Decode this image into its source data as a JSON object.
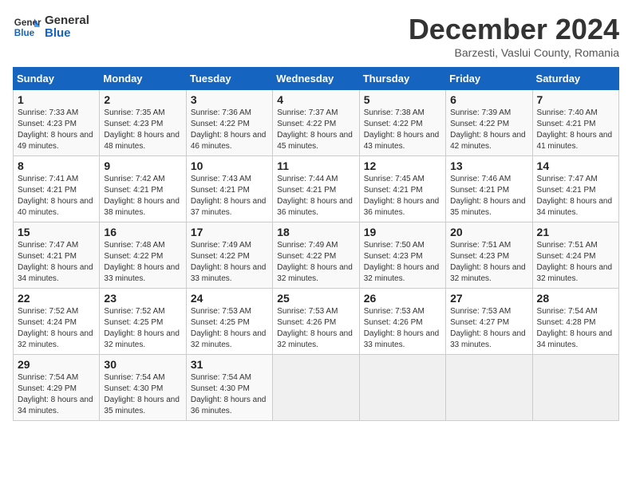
{
  "header": {
    "logo_line1": "General",
    "logo_line2": "Blue",
    "month": "December 2024",
    "location": "Barzesti, Vaslui County, Romania"
  },
  "weekdays": [
    "Sunday",
    "Monday",
    "Tuesday",
    "Wednesday",
    "Thursday",
    "Friday",
    "Saturday"
  ],
  "weeks": [
    [
      {
        "day": "1",
        "sunrise": "7:33 AM",
        "sunset": "4:23 PM",
        "daylight": "8 hours and 49 minutes."
      },
      {
        "day": "2",
        "sunrise": "7:35 AM",
        "sunset": "4:23 PM",
        "daylight": "8 hours and 48 minutes."
      },
      {
        "day": "3",
        "sunrise": "7:36 AM",
        "sunset": "4:22 PM",
        "daylight": "8 hours and 46 minutes."
      },
      {
        "day": "4",
        "sunrise": "7:37 AM",
        "sunset": "4:22 PM",
        "daylight": "8 hours and 45 minutes."
      },
      {
        "day": "5",
        "sunrise": "7:38 AM",
        "sunset": "4:22 PM",
        "daylight": "8 hours and 43 minutes."
      },
      {
        "day": "6",
        "sunrise": "7:39 AM",
        "sunset": "4:22 PM",
        "daylight": "8 hours and 42 minutes."
      },
      {
        "day": "7",
        "sunrise": "7:40 AM",
        "sunset": "4:21 PM",
        "daylight": "8 hours and 41 minutes."
      }
    ],
    [
      {
        "day": "8",
        "sunrise": "7:41 AM",
        "sunset": "4:21 PM",
        "daylight": "8 hours and 40 minutes."
      },
      {
        "day": "9",
        "sunrise": "7:42 AM",
        "sunset": "4:21 PM",
        "daylight": "8 hours and 38 minutes."
      },
      {
        "day": "10",
        "sunrise": "7:43 AM",
        "sunset": "4:21 PM",
        "daylight": "8 hours and 37 minutes."
      },
      {
        "day": "11",
        "sunrise": "7:44 AM",
        "sunset": "4:21 PM",
        "daylight": "8 hours and 36 minutes."
      },
      {
        "day": "12",
        "sunrise": "7:45 AM",
        "sunset": "4:21 PM",
        "daylight": "8 hours and 36 minutes."
      },
      {
        "day": "13",
        "sunrise": "7:46 AM",
        "sunset": "4:21 PM",
        "daylight": "8 hours and 35 minutes."
      },
      {
        "day": "14",
        "sunrise": "7:47 AM",
        "sunset": "4:21 PM",
        "daylight": "8 hours and 34 minutes."
      }
    ],
    [
      {
        "day": "15",
        "sunrise": "7:47 AM",
        "sunset": "4:21 PM",
        "daylight": "8 hours and 34 minutes."
      },
      {
        "day": "16",
        "sunrise": "7:48 AM",
        "sunset": "4:22 PM",
        "daylight": "8 hours and 33 minutes."
      },
      {
        "day": "17",
        "sunrise": "7:49 AM",
        "sunset": "4:22 PM",
        "daylight": "8 hours and 33 minutes."
      },
      {
        "day": "18",
        "sunrise": "7:49 AM",
        "sunset": "4:22 PM",
        "daylight": "8 hours and 32 minutes."
      },
      {
        "day": "19",
        "sunrise": "7:50 AM",
        "sunset": "4:23 PM",
        "daylight": "8 hours and 32 minutes."
      },
      {
        "day": "20",
        "sunrise": "7:51 AM",
        "sunset": "4:23 PM",
        "daylight": "8 hours and 32 minutes."
      },
      {
        "day": "21",
        "sunrise": "7:51 AM",
        "sunset": "4:24 PM",
        "daylight": "8 hours and 32 minutes."
      }
    ],
    [
      {
        "day": "22",
        "sunrise": "7:52 AM",
        "sunset": "4:24 PM",
        "daylight": "8 hours and 32 minutes."
      },
      {
        "day": "23",
        "sunrise": "7:52 AM",
        "sunset": "4:25 PM",
        "daylight": "8 hours and 32 minutes."
      },
      {
        "day": "24",
        "sunrise": "7:53 AM",
        "sunset": "4:25 PM",
        "daylight": "8 hours and 32 minutes."
      },
      {
        "day": "25",
        "sunrise": "7:53 AM",
        "sunset": "4:26 PM",
        "daylight": "8 hours and 32 minutes."
      },
      {
        "day": "26",
        "sunrise": "7:53 AM",
        "sunset": "4:26 PM",
        "daylight": "8 hours and 33 minutes."
      },
      {
        "day": "27",
        "sunrise": "7:53 AM",
        "sunset": "4:27 PM",
        "daylight": "8 hours and 33 minutes."
      },
      {
        "day": "28",
        "sunrise": "7:54 AM",
        "sunset": "4:28 PM",
        "daylight": "8 hours and 34 minutes."
      }
    ],
    [
      {
        "day": "29",
        "sunrise": "7:54 AM",
        "sunset": "4:29 PM",
        "daylight": "8 hours and 34 minutes."
      },
      {
        "day": "30",
        "sunrise": "7:54 AM",
        "sunset": "4:30 PM",
        "daylight": "8 hours and 35 minutes."
      },
      {
        "day": "31",
        "sunrise": "7:54 AM",
        "sunset": "4:30 PM",
        "daylight": "8 hours and 36 minutes."
      },
      null,
      null,
      null,
      null
    ]
  ]
}
